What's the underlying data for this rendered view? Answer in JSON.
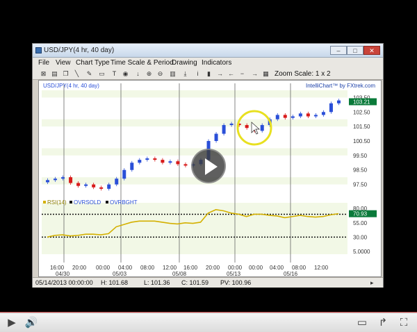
{
  "window": {
    "title": "USD/JPY(4 hr, 40 day)",
    "minimize": "–",
    "maximize": "□",
    "close": "✕"
  },
  "menu": [
    "File",
    "View",
    "Chart Type",
    "Time Scale & Period",
    "Drawing",
    "Indicators"
  ],
  "toolbar": {
    "zoom_label": "Zoom Scale: 1 x 2"
  },
  "chart": {
    "symbol_label": "USD/JPY(4 hr, 40 day)",
    "branding": "IntelliChart™ by FXtrek.com",
    "last_price_badge": "103.21",
    "rsi_badge": "70.93",
    "rsi_legend": [
      "RSI(14)",
      "OVRSOLD",
      "OVRBGHT"
    ],
    "price_ticks": [
      "103.50",
      "102.50",
      "101.50",
      "100.50",
      "99.50",
      "98.50",
      "97.50"
    ],
    "rsi_ticks": [
      "80.00",
      "55.00",
      "30.00",
      "5.0000"
    ],
    "time_ticks": [
      "16:00",
      "20:00",
      "00:00",
      "04:00",
      "08:00",
      "12:00",
      "16:00",
      "20:00",
      "00:00",
      "00:00",
      "04:00",
      "08:00",
      "12:00"
    ],
    "date_ticks": [
      "04/30",
      "05/03",
      "05/08",
      "05/13",
      "05/16"
    ],
    "colors": {
      "bull": "#2a4fd8",
      "bear": "#d81a1a",
      "rsi": "#d4b000",
      "grid_band": "#f2f8e6",
      "badge_green": "#0a7a3a"
    }
  },
  "status": {
    "date": "05/14/2013 00:00:00",
    "high": "H: 101.68",
    "low": "L: 101.36",
    "close": "C: 101.59",
    "pv": "PV: 100.96"
  },
  "chart_data": {
    "type": "candlestick",
    "price_axis_ticks": [
      103.5,
      102.5,
      101.5,
      100.5,
      99.5,
      98.5,
      97.5
    ],
    "rsi_axis_ticks": [
      80,
      55,
      30,
      5
    ],
    "overbought": 70,
    "oversold": 30,
    "close_path": [
      97.8,
      97.9,
      98.0,
      97.6,
      97.4,
      97.5,
      97.3,
      97.2,
      97.5,
      97.9,
      98.5,
      99.0,
      99.2,
      99.3,
      99.2,
      99.0,
      99.1,
      98.9,
      98.8,
      98.9,
      99.2,
      100.5,
      101.0,
      101.6,
      101.7,
      101.6,
      101.4,
      101.2,
      101.6,
      102.0,
      102.3,
      102.1,
      102.2,
      102.4,
      102.2,
      102.3,
      102.5,
      103.1,
      103.3
    ],
    "rsi_path": [
      30,
      33,
      34,
      32,
      33,
      35,
      35,
      34,
      36,
      48,
      52,
      56,
      58,
      58,
      58,
      56,
      54,
      53,
      55,
      54,
      56,
      72,
      78,
      76,
      72,
      70,
      66,
      70,
      70,
      68,
      67,
      64,
      66,
      68,
      66,
      65,
      66,
      69,
      71
    ]
  }
}
